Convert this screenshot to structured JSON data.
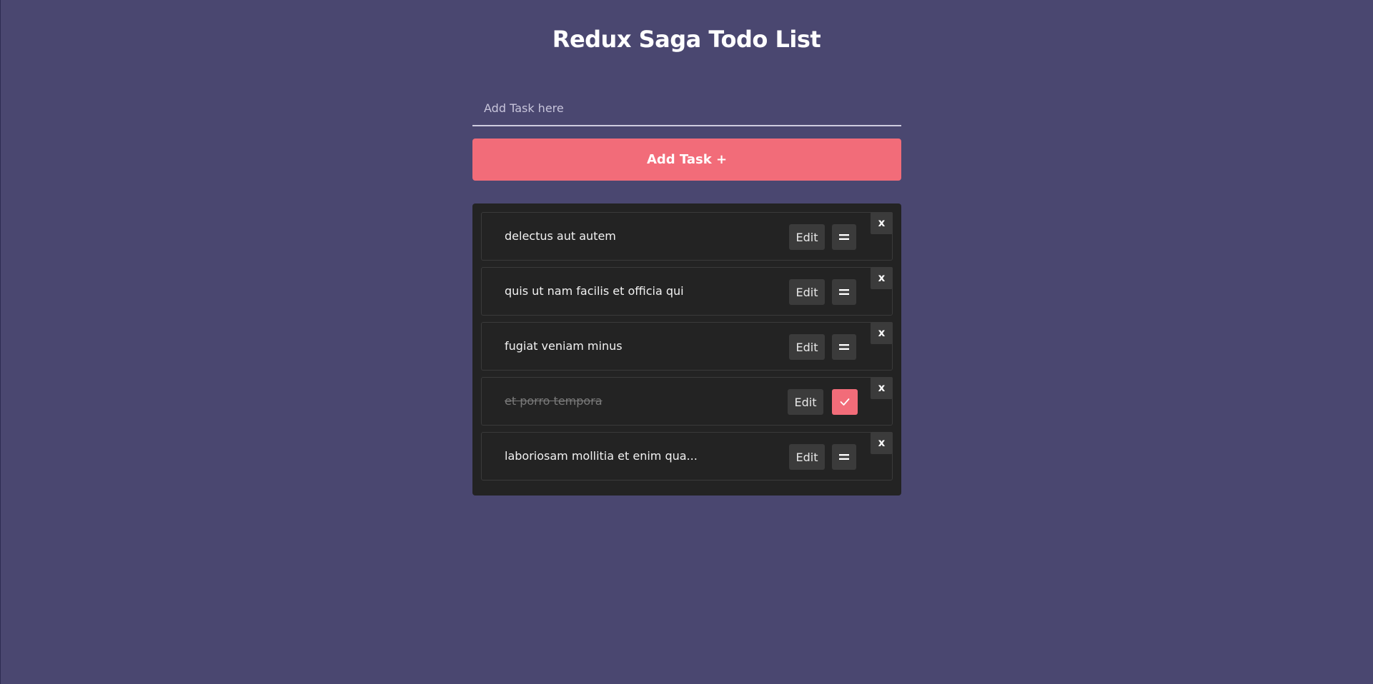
{
  "header": {
    "title": "Redux Saga Todo List"
  },
  "form": {
    "placeholder": "Add Task here",
    "value": "",
    "add_button_label": "Add Task +"
  },
  "tasks": [
    {
      "text": "delectus aut autem",
      "edit_label": "Edit",
      "delete_label": "x",
      "completed": false,
      "status_icon": "equals-icon"
    },
    {
      "text": "quis ut nam facilis et officia qui",
      "edit_label": "Edit",
      "delete_label": "x",
      "completed": false,
      "status_icon": "equals-icon"
    },
    {
      "text": "fugiat veniam minus",
      "edit_label": "Edit",
      "delete_label": "x",
      "completed": false,
      "status_icon": "equals-icon"
    },
    {
      "text": "et porro tempora",
      "edit_label": "Edit",
      "delete_label": "x",
      "completed": true,
      "status_icon": "check-icon"
    },
    {
      "text": "laboriosam mollitia et enim qua...",
      "edit_label": "Edit",
      "delete_label": "x",
      "completed": false,
      "status_icon": "equals-icon"
    }
  ],
  "colors": {
    "background": "#4a4770",
    "panel": "#232323",
    "accent": "#f26c79",
    "button": "#3b3b3b"
  }
}
